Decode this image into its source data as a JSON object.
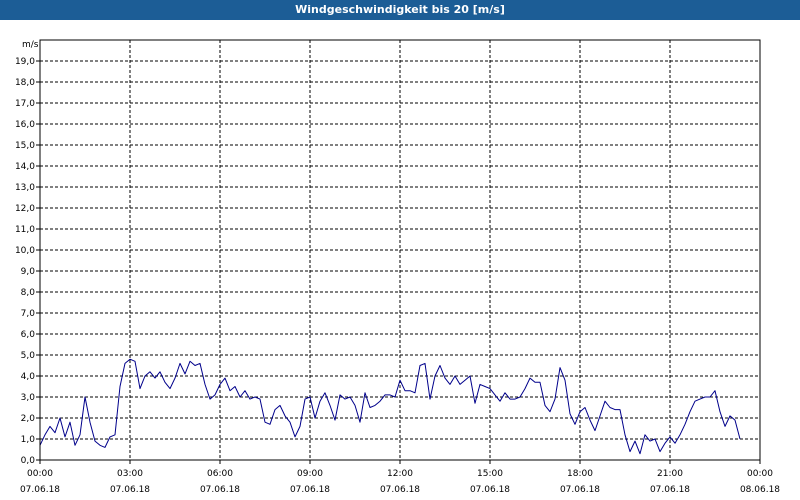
{
  "title": "Windgeschwindigkeit bis 20 [m/s]",
  "colors": {
    "title_bar": "#1c5d96",
    "line": "#00008b",
    "grid": "#000000",
    "background": "#ffffff"
  },
  "chart_data": {
    "type": "line",
    "title": "Windgeschwindigkeit bis 20 [m/s]",
    "ylabel": "m/s",
    "ylim": [
      0,
      20
    ],
    "yticks": [
      "0,0",
      "1,0",
      "2,0",
      "3,0",
      "4,0",
      "5,0",
      "6,0",
      "7,0",
      "8,0",
      "9,0",
      "10,0",
      "11,0",
      "12,0",
      "13,0",
      "14,0",
      "15,0",
      "16,0",
      "17,0",
      "18,0",
      "19,0"
    ],
    "xlim_hours": [
      0,
      24
    ],
    "xticks": [
      {
        "time": "00:00",
        "date": "07.06.18"
      },
      {
        "time": "03:00",
        "date": "07.06.18"
      },
      {
        "time": "06:00",
        "date": "07.06.18"
      },
      {
        "time": "09:00",
        "date": "07.06.18"
      },
      {
        "time": "12:00",
        "date": "07.06.18"
      },
      {
        "time": "15:00",
        "date": "07.06.18"
      },
      {
        "time": "18:00",
        "date": "07.06.18"
      },
      {
        "time": "21:00",
        "date": "07.06.18"
      },
      {
        "time": "00:00",
        "date": "08.06.18"
      }
    ],
    "grid": true,
    "series": [
      {
        "x_hours": [
          0,
          0.167,
          0.333,
          0.5,
          0.667,
          0.833,
          1,
          1.167,
          1.333,
          1.5,
          1.667,
          1.833,
          2,
          2.167,
          2.333,
          2.5,
          2.667,
          2.833,
          3,
          3.167,
          3.333,
          3.5,
          3.667,
          3.833,
          4,
          4.167,
          4.333,
          4.5,
          4.667,
          4.833,
          5,
          5.167,
          5.333,
          5.5,
          5.667,
          5.833,
          6,
          6.167,
          6.333,
          6.5,
          6.667,
          6.833,
          7,
          7.167,
          7.333,
          7.5,
          7.667,
          7.833,
          8,
          8.167,
          8.333,
          8.5,
          8.667,
          8.833,
          9,
          9.167,
          9.333,
          9.5,
          9.667,
          9.833,
          10,
          10.167,
          10.333,
          10.5,
          10.667,
          10.833,
          11,
          11.167,
          11.333,
          11.5,
          11.667,
          11.833,
          12,
          12.167,
          12.333,
          12.5,
          12.667,
          12.833,
          13,
          13.167,
          13.333,
          13.5,
          13.667,
          13.833,
          14,
          14.167,
          14.333,
          14.5,
          14.667,
          14.833,
          15,
          15.167,
          15.333,
          15.5,
          15.667,
          15.833,
          16,
          16.167,
          16.333,
          16.5,
          16.667,
          16.833,
          17,
          17.167,
          17.333,
          17.5,
          17.667,
          17.833,
          18,
          18.167,
          18.333,
          18.5,
          18.667,
          18.833,
          19,
          19.167,
          19.333,
          19.5,
          19.667,
          19.833,
          20,
          20.167,
          20.333,
          20.5,
          20.667,
          20.833,
          21,
          21.167,
          21.333,
          21.5,
          21.667,
          21.833,
          22,
          22.167,
          22.333,
          22.5,
          22.667,
          22.833,
          23,
          23.167,
          23.333,
          23.5,
          23.667,
          23.833,
          24
        ],
        "values": [
          0.7,
          1.2,
          1.6,
          1.3,
          2.0,
          1.1,
          1.8,
          0.7,
          1.2,
          3.0,
          1.8,
          0.9,
          0.7,
          0.6,
          1.1,
          1.2,
          3.5,
          4.6,
          4.8,
          4.7,
          3.4,
          4.0,
          4.2,
          3.9,
          4.2,
          3.7,
          3.4,
          3.9,
          4.6,
          4.1,
          4.7,
          4.5,
          4.6,
          3.6,
          2.9,
          3.1,
          3.6,
          3.9,
          3.3,
          3.5,
          3.0,
          3.3,
          2.9,
          3.0,
          2.9,
          1.8,
          1.7,
          2.4,
          2.6,
          2.1,
          1.8,
          1.1,
          1.6,
          2.9,
          3.0,
          2.0,
          2.8,
          3.2,
          2.6,
          1.9,
          3.1,
          2.9,
          3.0,
          2.6,
          1.8,
          3.2,
          2.5,
          2.6,
          2.8,
          3.1,
          3.1,
          3.0,
          3.8,
          3.3,
          3.3,
          3.2,
          4.5,
          4.6,
          2.9,
          4.0,
          4.5,
          3.9,
          3.6,
          4.0,
          3.6,
          3.8,
          4.0,
          2.7,
          3.6,
          3.5,
          3.4,
          3.1,
          2.8,
          3.2,
          2.9,
          2.9,
          3.0,
          3.4,
          3.9,
          3.7,
          3.7,
          2.6,
          2.3,
          2.9,
          4.4,
          3.8,
          2.2,
          1.7,
          2.3,
          2.5,
          1.9,
          1.4,
          2.1,
          2.8,
          2.5,
          2.4,
          2.4,
          1.2,
          0.4,
          0.9,
          0.3,
          1.2,
          0.9,
          1.0,
          0.4,
          0.8,
          1.1,
          0.8,
          1.2,
          1.7,
          2.3,
          2.8,
          2.9,
          3.0,
          3.0,
          3.3,
          2.3,
          1.6,
          2.1,
          1.9,
          1.0
        ]
      }
    ]
  }
}
